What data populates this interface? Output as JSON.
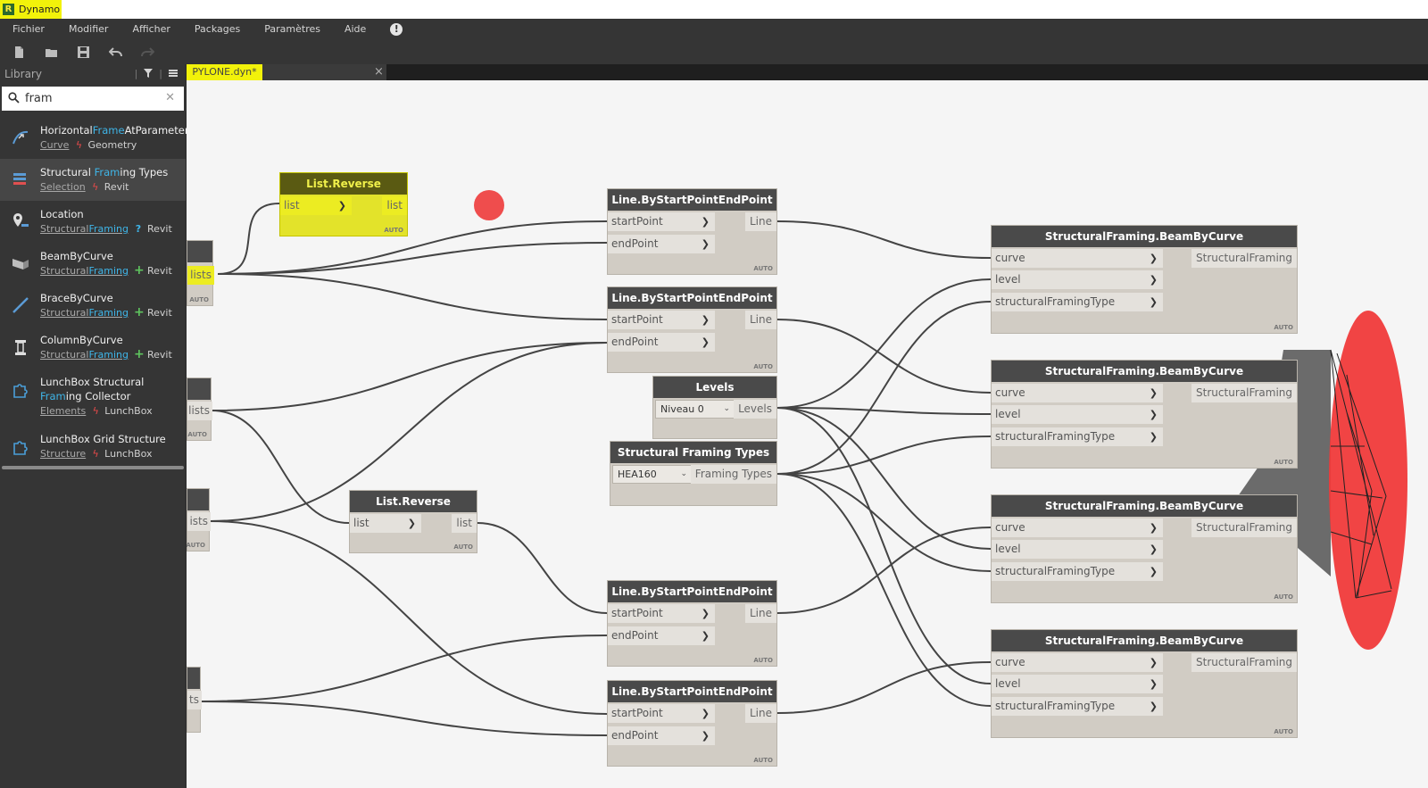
{
  "app": {
    "logo_letter": "R",
    "title": "Dynamo"
  },
  "menu": [
    "Fichier",
    "Modifier",
    "Afficher",
    "Packages",
    "Paramètres",
    "Aide"
  ],
  "menu_alert_glyph": "!",
  "toolbar": {
    "icons": [
      "new-file-icon",
      "open-file-icon",
      "save-icon",
      "undo-icon",
      "redo-icon"
    ]
  },
  "library": {
    "title": "Library",
    "search_value": "fram",
    "items": [
      {
        "name_parts": [
          "Horizontal",
          "Frame",
          "AtParameter"
        ],
        "cat_parts": [
          "Curve",
          "",
          ""
        ],
        "type": "bolt",
        "pkg": "Geometry"
      },
      {
        "name_parts": [
          "Structural ",
          "Fram",
          "ing Types"
        ],
        "cat_parts": [
          "Selection",
          "",
          ""
        ],
        "type": "bolt",
        "pkg": "Revit"
      },
      {
        "name_parts": [
          "Location",
          "",
          ""
        ],
        "cat_parts": [
          "Structural",
          "Framing",
          ""
        ],
        "type": "query",
        "pkg": "Revit"
      },
      {
        "name_parts": [
          "BeamByCurve",
          "",
          ""
        ],
        "cat_parts": [
          "Structural",
          "Framing",
          ""
        ],
        "type": "plus",
        "pkg": "Revit"
      },
      {
        "name_parts": [
          "BraceByCurve",
          "",
          ""
        ],
        "cat_parts": [
          "Structural",
          "Framing",
          ""
        ],
        "type": "plus",
        "pkg": "Revit"
      },
      {
        "name_parts": [
          "ColumnByCurve",
          "",
          ""
        ],
        "cat_parts": [
          "Structural",
          "Framing",
          ""
        ],
        "type": "plus",
        "pkg": "Revit"
      },
      {
        "name_parts": [
          "LunchBox Structural ",
          "Fram",
          "ing Collector"
        ],
        "cat_parts": [
          "Elements",
          "",
          ""
        ],
        "type": "bolt",
        "pkg": "LunchBox"
      },
      {
        "name_parts": [
          "LunchBox Grid Structure",
          "",
          ""
        ],
        "cat_parts": [
          "Structure",
          "",
          ""
        ],
        "type": "bolt",
        "pkg": "LunchBox"
      }
    ]
  },
  "tab": {
    "label": "PYLONE.dyn*",
    "close": "×"
  },
  "labels": {
    "auto": "AUTO",
    "list": "list",
    "start": "startPoint",
    "end": "endPoint",
    "line": "Line",
    "curve": "curve",
    "level": "level",
    "sft": "structuralFramingType",
    "sf": "StructuralFraming",
    "lists": "lists",
    "lists_cut1": "ists",
    "lists_cut2": "ts"
  },
  "nodes": {
    "reverse1": "List.Reverse",
    "reverse2": "List.Reverse",
    "line1": "Line.ByStartPointEndPoint",
    "line2": "Line.ByStartPointEndPoint",
    "line3": "Line.ByStartPointEndPoint",
    "line4": "Line.ByStartPointEndPoint",
    "levels": {
      "title": "Levels",
      "value": "Niveau 0",
      "out": "Levels"
    },
    "sftypes": {
      "title": "Structural Framing Types",
      "value": "HEA160",
      "out": "Framing Types"
    },
    "beam1": "StructuralFraming.BeamByCurve",
    "beam2": "StructuralFraming.BeamByCurve",
    "beam3": "StructuralFraming.BeamByCurve",
    "beam4": "StructuralFraming.BeamByCurve"
  }
}
